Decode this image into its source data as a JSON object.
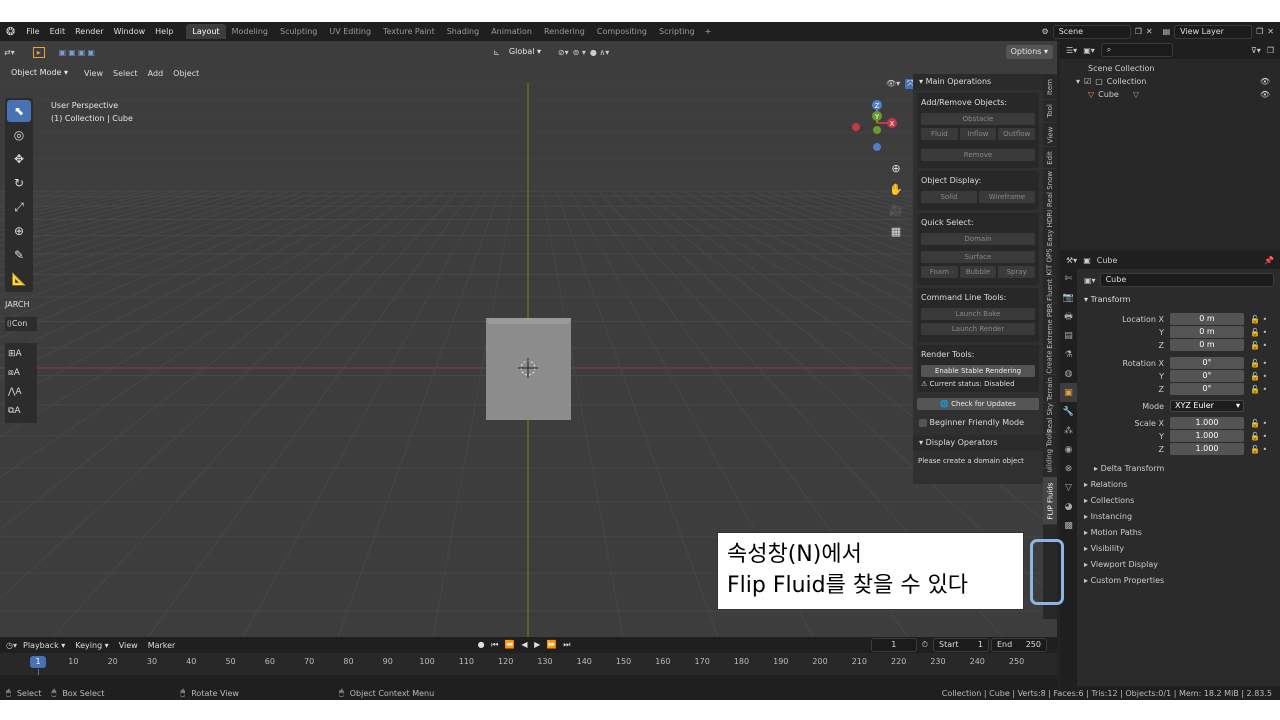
{
  "menu": [
    "File",
    "Edit",
    "Render",
    "Window",
    "Help"
  ],
  "workspaces": [
    "Layout",
    "Modeling",
    "Sculpting",
    "UV Editing",
    "Texture Paint",
    "Shading",
    "Animation",
    "Rendering",
    "Compositing",
    "Scripting"
  ],
  "active_workspace": "Layout",
  "scene": {
    "name": "Scene",
    "view_layer": "View Layer"
  },
  "viewport": {
    "orientation": "Global",
    "options": "Options",
    "mode": "Object Mode",
    "menus": [
      "View",
      "Select",
      "Add",
      "Object"
    ],
    "overlay_title": "User Perspective",
    "overlay_subtitle": "(1) Collection | Cube",
    "gizmo": {
      "x": "X",
      "y": "Y",
      "z": "Z"
    },
    "jarch_label": "JARCH",
    "jarch_con": "Con"
  },
  "npanel": {
    "main_title": "Main Operations",
    "add_remove": "Add/Remove Objects:",
    "obstacle": "Obstacle",
    "fluid": "Fluid",
    "inflow": "Inflow",
    "outflow": "Outflow",
    "remove": "Remove",
    "object_display": "Object Display:",
    "solid": "Solid",
    "wireframe": "Wireframe",
    "quick_select": "Quick Select:",
    "domain": "Domain",
    "surface": "Surface",
    "foam": "Foam",
    "bubble": "Bubble",
    "spray": "Spray",
    "cmd_tools": "Command Line Tools:",
    "launch_bake": "Launch Bake",
    "launch_render": "Launch Render",
    "render_tools": "Render Tools:",
    "enable_stable": "Enable Stable Rendering",
    "current_status": "Current status: Disabled",
    "check_updates": "Check for Updates",
    "beginner": "Beginner Friendly Mode",
    "display_ops": "Display Operators",
    "create_domain": "Please create a domain object"
  },
  "tabs": [
    "Item",
    "Tool",
    "View",
    "Edit",
    "Real Snow",
    "Easy HDRI",
    "KIT OPS",
    "Fluent",
    "Extreme PBR",
    "Create",
    "Terrain",
    "Real Sky",
    "uilding Tools",
    "FLIP Fluids"
  ],
  "outliner": {
    "scene_collection": "Scene Collection",
    "collection": "Collection",
    "cube": "Cube"
  },
  "properties": {
    "object_name": "Cube",
    "object_field": "Cube",
    "transform": "Transform",
    "location_x_label": "Location X",
    "rotation_x_label": "Rotation X",
    "scale_x_label": "Scale X",
    "y_label": "Y",
    "z_label": "Z",
    "loc_x": "0 m",
    "loc_y": "0 m",
    "loc_z": "0 m",
    "rot_x": "0°",
    "rot_y": "0°",
    "rot_z": "0°",
    "mode_label": "Mode",
    "mode_value": "XYZ Euler",
    "scale_x": "1.000",
    "scale_y": "1.000",
    "scale_z": "1.000",
    "delta": "Delta Transform",
    "sections": [
      "Relations",
      "Collections",
      "Instancing",
      "Motion Paths",
      "Visibility",
      "Viewport Display",
      "Custom Properties"
    ]
  },
  "timeline": {
    "menus": [
      "Playback",
      "Keying",
      "View",
      "Marker"
    ],
    "current_frame": "1",
    "start_label": "Start",
    "start": "1",
    "end_label": "End",
    "end": "250",
    "ruler": [
      "1",
      "10",
      "20",
      "30",
      "40",
      "50",
      "60",
      "70",
      "80",
      "90",
      "100",
      "110",
      "120",
      "130",
      "140",
      "150",
      "160",
      "170",
      "180",
      "190",
      "200",
      "210",
      "220",
      "230",
      "240",
      "250"
    ]
  },
  "status": {
    "select": "Select",
    "box_select": "Box Select",
    "rotate_view": "Rotate View",
    "context_menu": "Object Context Menu",
    "info": "Collection | Cube | Verts:8 | Faces:6 | Tris:12 | Objects:0/1 | Mem: 18.2 MiB | 2.83.5"
  },
  "callout": {
    "line1": "속성창(N)에서",
    "line2": "Flip Fluid를 찾을 수 있다"
  }
}
